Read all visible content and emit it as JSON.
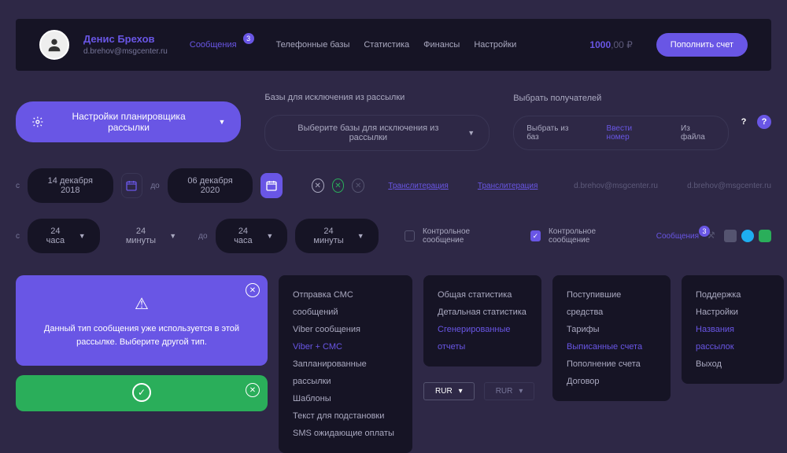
{
  "header": {
    "user_name": "Денис Брехов",
    "user_email": "d.brehov@msgcenter.ru",
    "nav": [
      "Сообщения",
      "Телефонные базы",
      "Статистика",
      "Финансы",
      "Настройки"
    ],
    "nav_badge": "3",
    "balance_amount": "1000",
    "balance_suffix": ",00 ₽",
    "topup": "Пополнить счет"
  },
  "scheduler_button": "Настройки планировщика рассылки",
  "exclusion": {
    "title": "Базы для исключения из рассылки",
    "select": "Выберите базы для исключения из рассылки"
  },
  "recipients": {
    "title": "Выбрать получателей",
    "opts": [
      "Выбрать из баз",
      "Ввести номер",
      "Из файла"
    ]
  },
  "dates": {
    "from_label": "с",
    "to_label": "до",
    "from_date": "14 декабря 2018",
    "to_date": "06 декабря 2020"
  },
  "translit_links": [
    "Транслитерация",
    "Транслитерация"
  ],
  "emails": [
    "d.brehov@msgcenter.ru",
    "d.brehov@msgcenter.ru"
  ],
  "times": {
    "from": "с",
    "to": "до",
    "hour": "24 часа",
    "min": "24 минуты"
  },
  "checks": {
    "label": "Контрольное сообщение",
    "msgs_link": "Сообщения",
    "msgs_badge": "3"
  },
  "alert_purple": "Данный тип сообщения уже используется в этой рассылке. Выберите другой тип.",
  "panel_msgs": [
    "Отправка СМС сообщений",
    "Viber сообщения",
    "Viber + СМС",
    "Запланированные рассылки",
    "Шаблоны",
    "Текст для подстановки",
    "SMS ожидающие оплаты"
  ],
  "panel_msgs_hl_index": 2,
  "panel_stats": [
    "Общая статистика",
    "Детальная статистика",
    "Сгенерированные отчеты"
  ],
  "panel_stats_hl_index": 2,
  "currency_sel": "RUR",
  "panel_finance": [
    "Поступившие средства",
    "Тарифы",
    "Выписанные счета",
    "Пополнение счета",
    "Договор"
  ],
  "panel_finance_hl_index": 2,
  "panel_settings": [
    "Поддержка",
    "Настройки",
    "Названия рассылок",
    "Выход"
  ],
  "panel_settings_hl_index": 2
}
